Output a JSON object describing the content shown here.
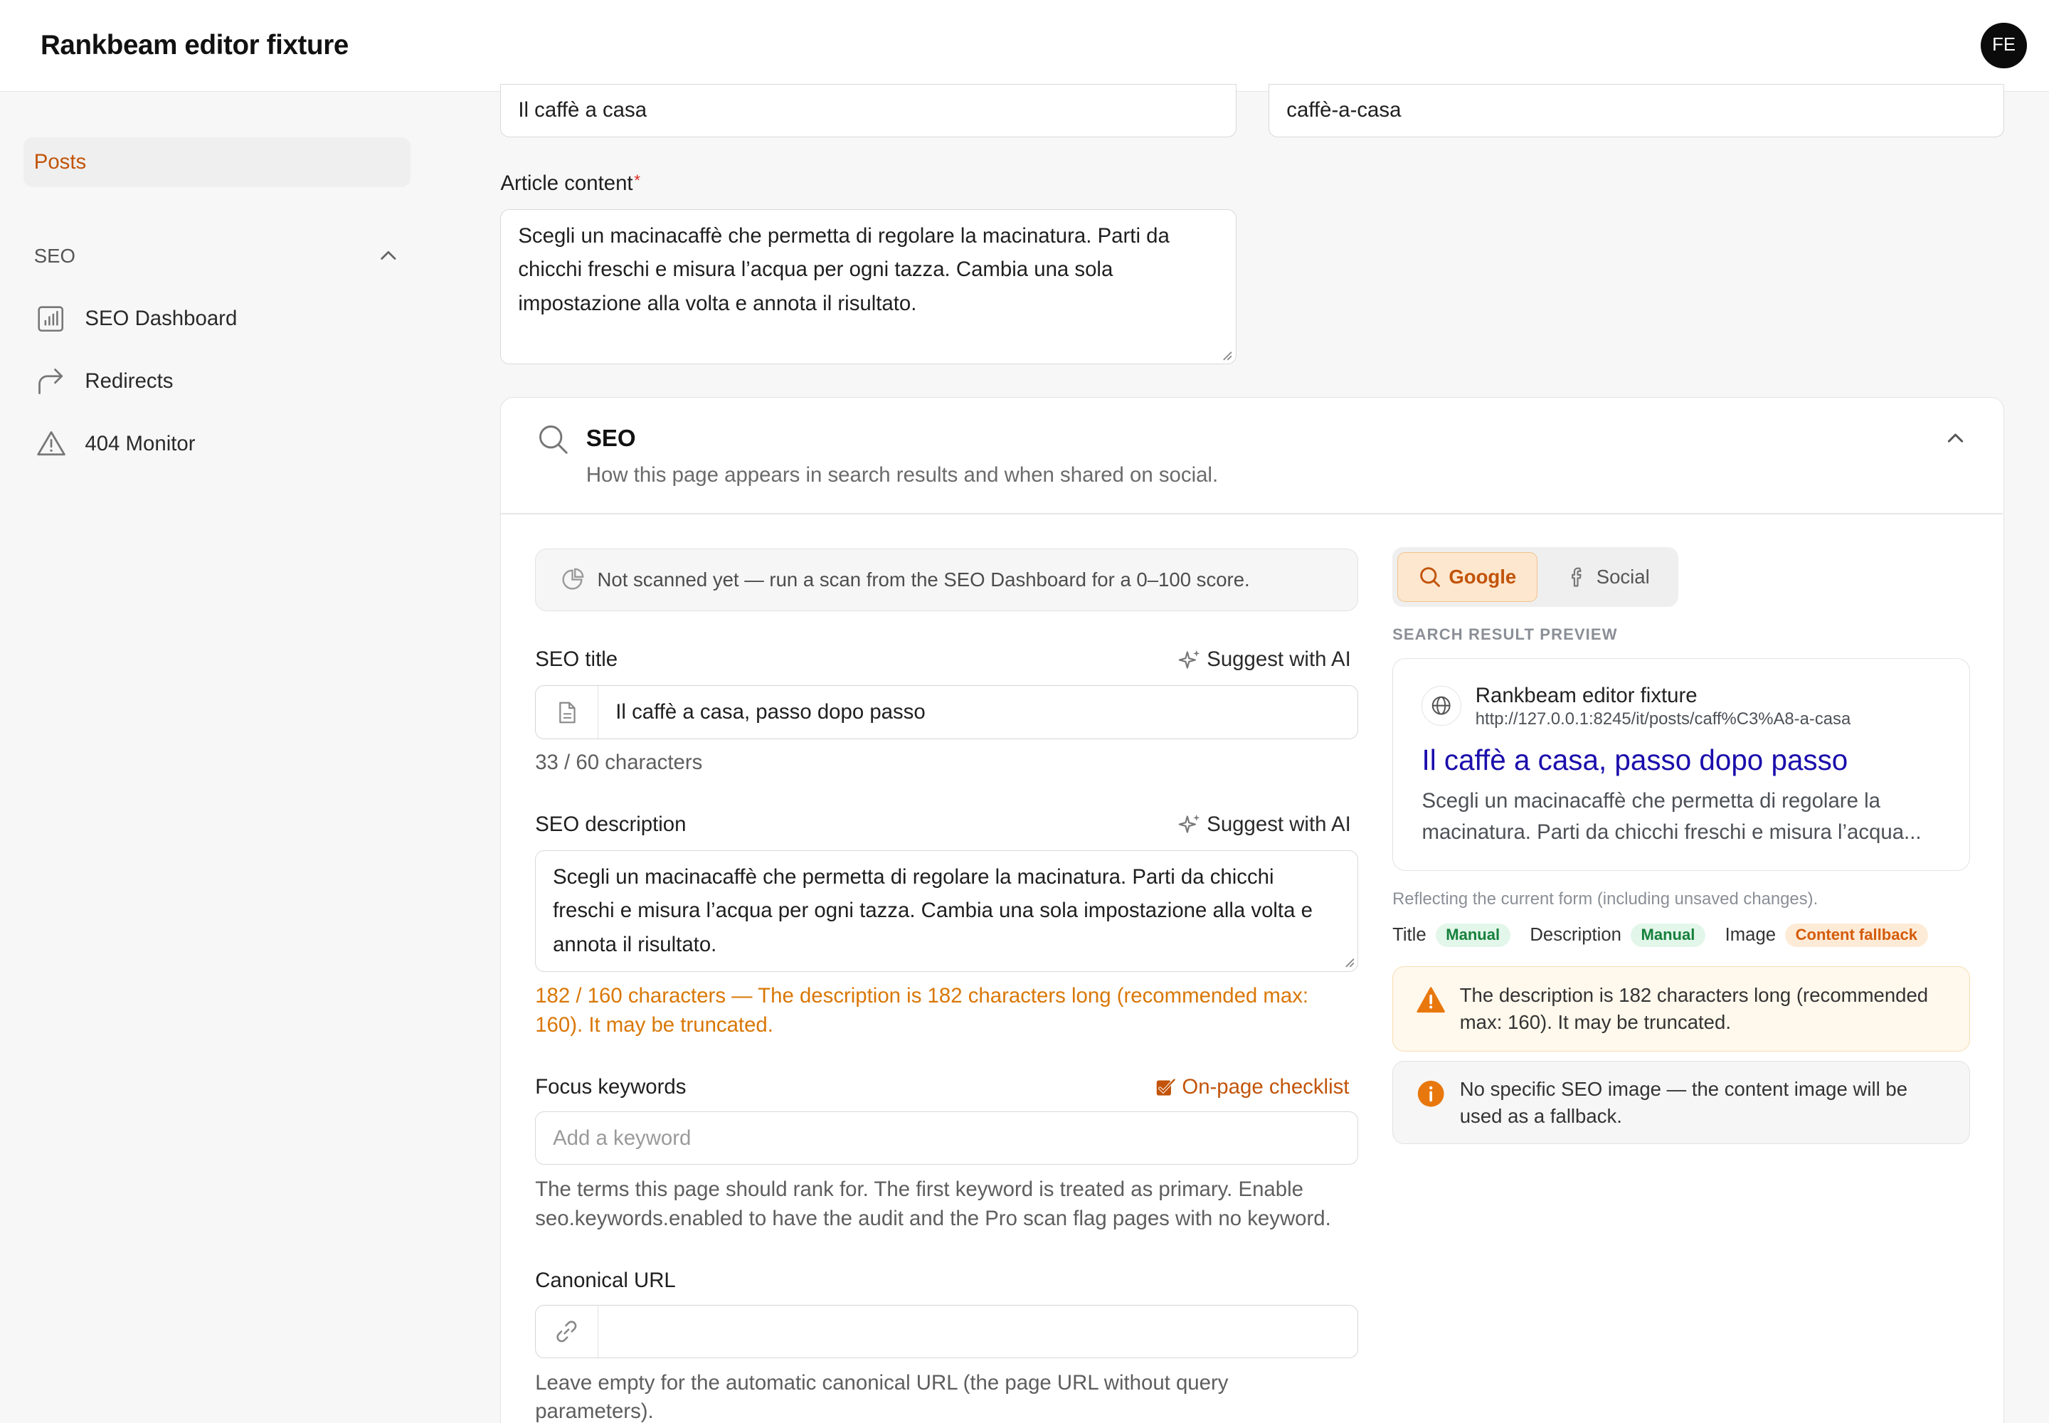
{
  "header": {
    "app_title": "Rankbeam editor fixture",
    "avatar_initials": "FE"
  },
  "sidebar": {
    "posts_label": "Posts",
    "seo_section_label": "SEO",
    "items": [
      {
        "label": "SEO Dashboard",
        "icon": "bar-chart-icon"
      },
      {
        "label": "Redirects",
        "icon": "redirect-arrow-icon"
      },
      {
        "label": "404 Monitor",
        "icon": "warning-triangle-icon"
      }
    ]
  },
  "article": {
    "title_value": "Il caffè a casa",
    "slug_value": "caffè-a-casa",
    "content_label": "Article content",
    "content_required_mark": "*",
    "content_value": "Scegli un macinacaffè che permetta di regolare la macinatura. Parti da chicchi freschi e misura l’acqua per ogni tazza. Cambia una sola impostazione alla volta e annota il risultato."
  },
  "seo": {
    "title": "SEO",
    "subtitle": "How this page appears in search results and when shared on social.",
    "scan_notice": "Not scanned yet — run a scan from the SEO Dashboard for a 0–100 score.",
    "seo_title_label": "SEO title",
    "suggest_ai_label": "Suggest with AI",
    "seo_title_value": "Il caffè a casa, passo dopo passo",
    "seo_title_count": "33 / 60 characters",
    "seo_description_label": "SEO description",
    "seo_description_value": "Scegli un macinacaffè che permetta di regolare la macinatura. Parti da chicchi freschi e misura l’acqua per ogni tazza. Cambia una sola impostazione alla volta e annota il risultato.",
    "seo_description_warning": "182 / 160 characters — The description is 182 characters long (recommended max: 160). It may be truncated.",
    "focus_keywords_label": "Focus keywords",
    "onpage_checklist_label": "On-page checklist",
    "keyword_placeholder": "Add a keyword",
    "keywords_hint": "The terms this page should rank for. The first keyword is treated as primary. Enable seo.keywords.enabled to have the audit and the Pro scan flag pages with no keyword.",
    "canonical_label": "Canonical URL",
    "canonical_value": "",
    "canonical_hint": "Leave empty for the automatic canonical URL (the page URL without query parameters).",
    "preview_tabs": [
      "Google",
      "Social"
    ],
    "active_tab": "Google",
    "preview_caption": "SEARCH RESULT PREVIEW",
    "serp": {
      "site_name": "Rankbeam editor fixture",
      "url": "http://127.0.0.1:8245/it/posts/caff%C3%A8-a-casa",
      "title": "Il caffè a casa, passo dopo passo",
      "description": "Scegli un macinacaffè che permetta di regolare la macinatura. Parti da chicchi freschi e misura l’acqua..."
    },
    "reflecting_note": "Reflecting the current form (including unsaved changes).",
    "sources": [
      {
        "label": "Title",
        "badge": "Manual",
        "tone": "green"
      },
      {
        "label": "Description",
        "badge": "Manual",
        "tone": "green"
      },
      {
        "label": "Image",
        "badge": "Content fallback",
        "tone": "orange"
      }
    ],
    "alert_warning": "The description is 182 characters long (recommended max: 160). It may be truncated.",
    "alert_info": "No specific SEO image — the content image will be used as a fallback."
  },
  "colors": {
    "accent": "#c2540a",
    "warning_text": "#d97706",
    "serp_title": "#1a0dab",
    "badge_green": "#16803c",
    "badge_orange": "#d45c0b"
  }
}
